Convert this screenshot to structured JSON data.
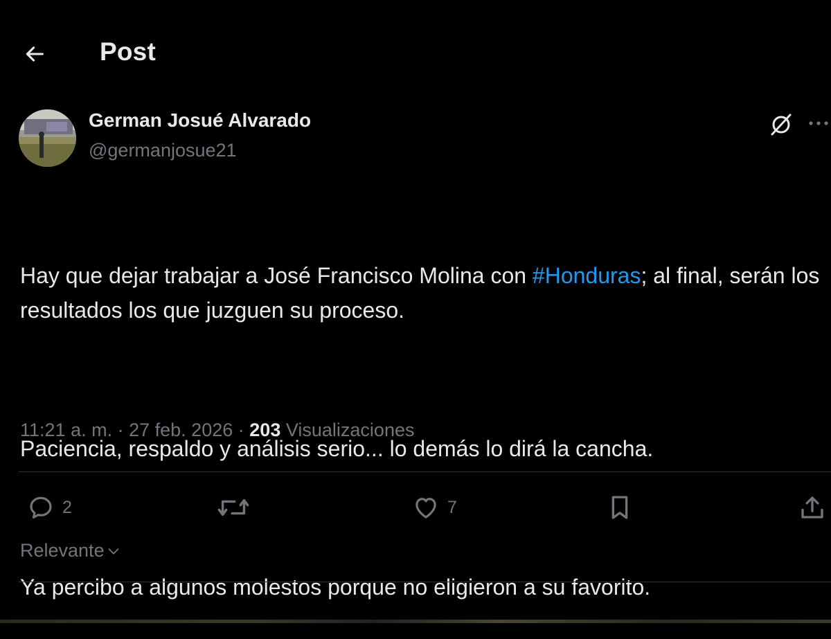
{
  "header": {
    "title": "Post",
    "back_icon": "arrow-left-icon"
  },
  "author": {
    "display_name": "German Josué Alvarado",
    "handle": "@germanjosue21"
  },
  "tweet": {
    "line1_prefix": "Hay que dejar trabajar a José Francisco Molina con ",
    "hashtag": "#Honduras",
    "line1_suffix": "; al final, serán los resultados los que juzguen su proceso.",
    "paragraph2": "Paciencia, respaldo y análisis serio... lo demás lo dirá la cancha.",
    "paragraph3": "Ya percibo a algunos molestos porque no eligieron a su favorito."
  },
  "meta": {
    "time": "11:21 a. m.",
    "separator": "·",
    "date": "27 feb. 2026",
    "views_count": "203",
    "views_label": "Visualizaciones"
  },
  "actions": {
    "reply_count": "2",
    "like_count": "7"
  },
  "sort": {
    "label": "Relevante"
  },
  "colors": {
    "background": "#000000",
    "text": "#e7e9ea",
    "secondary": "#71767b",
    "accent": "#1d9bf0",
    "divider": "#2f3336"
  }
}
